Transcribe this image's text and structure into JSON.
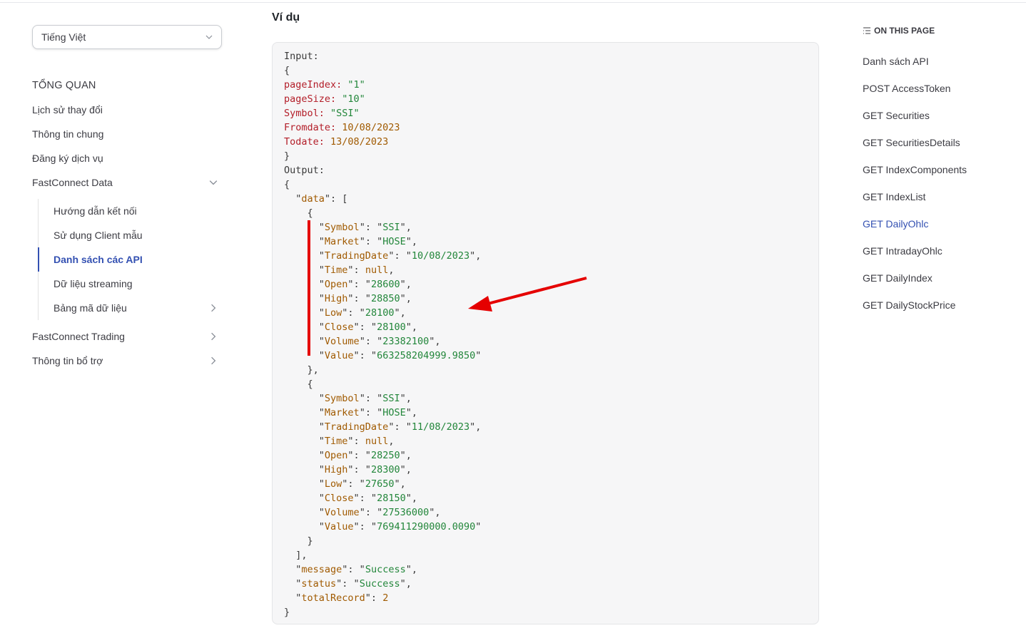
{
  "sidebar": {
    "language": "Tiếng Việt",
    "items": [
      {
        "label": "TỔNG QUAN"
      },
      {
        "label": "Lịch sử thay đổi"
      },
      {
        "label": "Thông tin chung"
      },
      {
        "label": "Đăng ký dịch vụ"
      },
      {
        "label": "FastConnect Data"
      }
    ],
    "subitems": [
      {
        "label": "Hướng dẫn kết nối"
      },
      {
        "label": "Sử dụng Client mẫu"
      },
      {
        "label": "Danh sách các API"
      },
      {
        "label": "Dữ liệu streaming"
      },
      {
        "label": "Bảng mã dữ liệu"
      }
    ],
    "bottom_items": [
      {
        "label": "FastConnect Trading"
      },
      {
        "label": "Thông tin bổ trợ"
      }
    ],
    "active_color": "#3451b2"
  },
  "main": {
    "title": "Ví dụ",
    "code_lines": [
      "Input:",
      "{",
      "pageIndex: \"1\"",
      "pageSize: \"10\"",
      "Symbol: \"SSI\"",
      "Fromdate: 10/08/2023",
      "Todate: 13/08/2023",
      "}",
      "Output:",
      "{",
      "  \"data\": [",
      "    {",
      "      \"Symbol\": \"SSI\",",
      "      \"Market\": \"HOSE\",",
      "      \"TradingDate\": \"10/08/2023\",",
      "      \"Time\": null,",
      "      \"Open\": \"28600\",",
      "      \"High\": \"28850\",",
      "      \"Low\": \"28100\",",
      "      \"Close\": \"28100\",",
      "      \"Volume\": \"23382100\",",
      "      \"Value\": \"663258204999.9850\"",
      "    },",
      "    {",
      "      \"Symbol\": \"SSI\",",
      "      \"Market\": \"HOSE\",",
      "      \"TradingDate\": \"11/08/2023\",",
      "      \"Time\": null,",
      "      \"Open\": \"28250\",",
      "      \"High\": \"28300\",",
      "      \"Low\": \"27650\",",
      "      \"Close\": \"28150\",",
      "      \"Volume\": \"27536000\",",
      "      \"Value\": \"769411290000.0090\"",
      "    }",
      "  ],",
      "  \"message\": \"Success\",",
      "  \"status\": \"Success\",",
      "  \"totalRecord\": 2",
      "}"
    ],
    "annotation_color": "#e50000"
  },
  "toc": {
    "title": "ON THIS PAGE",
    "items": [
      {
        "label": "Danh sách API"
      },
      {
        "label": "POST AccessToken"
      },
      {
        "label": "GET Securities"
      },
      {
        "label": "GET SecuritiesDetails"
      },
      {
        "label": "GET IndexComponents"
      },
      {
        "label": "GET IndexList"
      },
      {
        "label": "GET DailyOhlc"
      },
      {
        "label": "GET IntradayOhlc"
      },
      {
        "label": "GET DailyIndex"
      },
      {
        "label": "GET DailyStockPrice"
      }
    ]
  }
}
